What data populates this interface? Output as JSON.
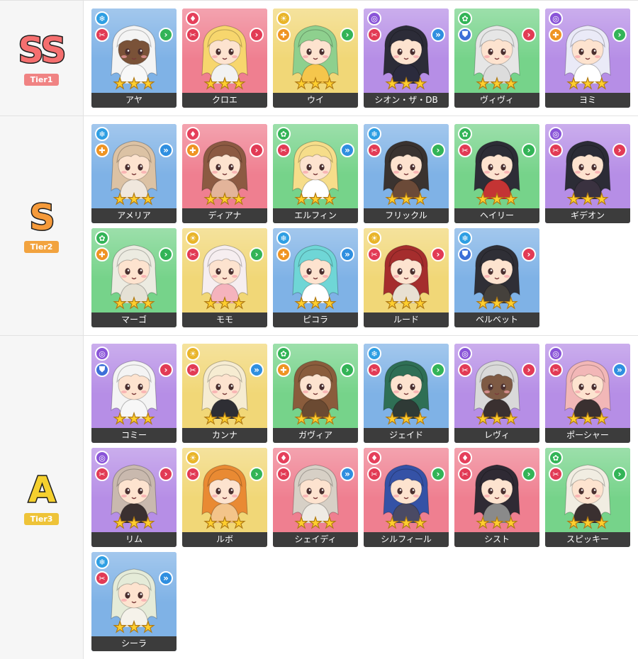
{
  "colors": {
    "bg": {
      "blue": "#7fb2e6",
      "red": "#ef7f90",
      "yellow": "#f1d777",
      "purple": "#b68ee6",
      "green": "#76d38a"
    },
    "elem": {
      "blue": "#2f9fe3",
      "red": "#e5405b",
      "yellow": "#e9b52a",
      "purple": "#8a55d8",
      "green": "#33b457"
    },
    "role": {
      "atk": "#e23b55",
      "heal": "#ef9423",
      "tank": "#3c6fd8"
    },
    "pos": {
      "front": "#e23b55",
      "mid": "#2f8fe0",
      "back": "#33b457"
    }
  },
  "icons": {
    "elem": {
      "blue": "❄",
      "red": "♦",
      "yellow": "☀",
      "purple": "◎",
      "green": "✿"
    },
    "role": {
      "atk": "✂",
      "heal": "✚",
      "tank": "⛊"
    },
    "pos": {
      "front": "›",
      "mid": "»",
      "back": "›"
    }
  },
  "tiers": [
    {
      "grade": "SS",
      "label": "Tier1",
      "grade_color": "#f56f6f",
      "badge_color": "#f08383",
      "units": [
        {
          "name": "アヤ",
          "elem": "blue",
          "role": "atk",
          "pos": "back",
          "hair": "#f4f4f4",
          "skin": "#7a5238",
          "outfit": "#f8f8f8"
        },
        {
          "name": "クロエ",
          "elem": "red",
          "role": "atk",
          "pos": "front",
          "hair": "#f7d66d",
          "skin": "#fde3cf",
          "outfit": "#f2f2f2"
        },
        {
          "name": "ウイ",
          "elem": "yellow",
          "role": "heal",
          "pos": "back",
          "hair": "#8ed08e",
          "skin": "#fde3cf",
          "outfit": "#f5c64c"
        },
        {
          "name": "シオン・ザ・DB",
          "elem": "purple",
          "role": "atk",
          "pos": "mid",
          "hair": "#2c2c38",
          "skin": "#fde3cf",
          "outfit": "#2b2b3d"
        },
        {
          "name": "ヴィヴィ",
          "elem": "green",
          "role": "tank",
          "pos": "front",
          "hair": "#e6e6e6",
          "skin": "#fde3cf",
          "outfit": "#dcdcdc"
        },
        {
          "name": "ヨミ",
          "elem": "purple",
          "role": "heal",
          "pos": "back",
          "hair": "#eaeaf7",
          "skin": "#fde3cf",
          "outfit": "#ffffff"
        }
      ]
    },
    {
      "grade": "S",
      "label": "Tier2",
      "grade_color": "#f59a3a",
      "badge_color": "#f2a33f",
      "units": [
        {
          "name": "アメリア",
          "elem": "blue",
          "role": "heal",
          "pos": "mid",
          "hair": "#dcc2a4",
          "skin": "#fde3cf",
          "outfit": "#f0e7dd"
        },
        {
          "name": "ディアナ",
          "elem": "red",
          "role": "heal",
          "pos": "front",
          "hair": "#8c5a42",
          "skin": "#fde3cf",
          "outfit": "#e3b49a"
        },
        {
          "name": "エルフィン",
          "elem": "green",
          "role": "atk",
          "pos": "mid",
          "hair": "#f6dd8a",
          "skin": "#fde3cf",
          "outfit": "#ffffff"
        },
        {
          "name": "フリックル",
          "elem": "blue",
          "role": "atk",
          "pos": "back",
          "hair": "#3a3330",
          "skin": "#fde3cf",
          "outfit": "#6b4a38"
        },
        {
          "name": "ヘイリー",
          "elem": "green",
          "role": "atk",
          "pos": "back",
          "hair": "#2d2d36",
          "skin": "#fde3cf",
          "outfit": "#c43434"
        },
        {
          "name": "ギデオン",
          "elem": "purple",
          "role": "atk",
          "pos": "front",
          "hair": "#2c2c36",
          "skin": "#fde3cf",
          "outfit": "#3a3240"
        },
        {
          "name": "マーゴ",
          "elem": "green",
          "role": "heal",
          "pos": "back",
          "hair": "#ecebe1",
          "skin": "#fde3cf",
          "outfit": "#e5e1d5"
        },
        {
          "name": "モモ",
          "elem": "yellow",
          "role": "atk",
          "pos": "back",
          "hair": "#f6eef0",
          "skin": "#fde3cf",
          "outfit": "#f5b3bd"
        },
        {
          "name": "ピコラ",
          "elem": "blue",
          "role": "heal",
          "pos": "mid",
          "hair": "#6fd6d6",
          "skin": "#fde3cf",
          "outfit": "#ffffff"
        },
        {
          "name": "ルード",
          "elem": "yellow",
          "role": "atk",
          "pos": "front",
          "hair": "#a52d2d",
          "skin": "#fde3cf",
          "outfit": "#e8e0d2"
        },
        {
          "name": "ベルベット",
          "elem": "blue",
          "role": "tank",
          "pos": "front",
          "hair": "#2f2f36",
          "skin": "#fde3cf",
          "outfit": "#45413c"
        }
      ]
    },
    {
      "grade": "A",
      "label": "Tier3",
      "grade_color": "#f5d02e",
      "badge_color": "#eec338",
      "units": [
        {
          "name": "コミー",
          "elem": "purple",
          "role": "tank",
          "pos": "front",
          "hair": "#f4f4f4",
          "skin": "#fde3cf",
          "outfit": "#f7f7f7"
        },
        {
          "name": "カンナ",
          "elem": "yellow",
          "role": "atk",
          "pos": "mid",
          "hair": "#f6ecd2",
          "skin": "#fde3cf",
          "outfit": "#2e2e34"
        },
        {
          "name": "ガヴィア",
          "elem": "green",
          "role": "heal",
          "pos": "back",
          "hair": "#8a5c3c",
          "skin": "#fde3cf",
          "outfit": "#6b4a32"
        },
        {
          "name": "ジェイド",
          "elem": "blue",
          "role": "atk",
          "pos": "back",
          "hair": "#2f6f55",
          "skin": "#fde3cf",
          "outfit": "#2f3a36"
        },
        {
          "name": "レヴィ",
          "elem": "purple",
          "role": "atk",
          "pos": "front",
          "hair": "#d9d9d9",
          "skin": "#7e5a44",
          "outfit": "#3a3030"
        },
        {
          "name": "ポーシャー",
          "elem": "purple",
          "role": "atk",
          "pos": "mid",
          "hair": "#f2b7b7",
          "skin": "#fde3cf",
          "outfit": "#3a3030"
        },
        {
          "name": "リム",
          "elem": "purple",
          "role": "atk",
          "pos": "front",
          "hair": "#c9b9ae",
          "skin": "#fde3cf",
          "outfit": "#3a3030"
        },
        {
          "name": "ルボ",
          "elem": "yellow",
          "role": "atk",
          "pos": "back",
          "hair": "#e98a33",
          "skin": "#fde3cf",
          "outfit": "#f3c48a"
        },
        {
          "name": "シェイディ",
          "elem": "red",
          "role": "atk",
          "pos": "mid",
          "hair": "#d7d0c6",
          "skin": "#fde3cf",
          "outfit": "#efebe4"
        },
        {
          "name": "シルフィール",
          "elem": "red",
          "role": "atk",
          "pos": "back",
          "hair": "#3552a6",
          "skin": "#fde3cf",
          "outfit": "#4a4a64"
        },
        {
          "name": "シスト",
          "elem": "red",
          "role": "atk",
          "pos": "back",
          "hair": "#2f2a34",
          "skin": "#fde3cf",
          "outfit": "#8a8a8a"
        },
        {
          "name": "スピッキー",
          "elem": "green",
          "role": "atk",
          "pos": "back",
          "hair": "#f1ede2",
          "skin": "#fde3cf",
          "outfit": "#3a3030"
        },
        {
          "name": "シーラ",
          "elem": "blue",
          "role": "atk",
          "pos": "mid",
          "hair": "#e5ebd8",
          "skin": "#fde3cf",
          "outfit": "#f5f2ea"
        }
      ]
    }
  ]
}
